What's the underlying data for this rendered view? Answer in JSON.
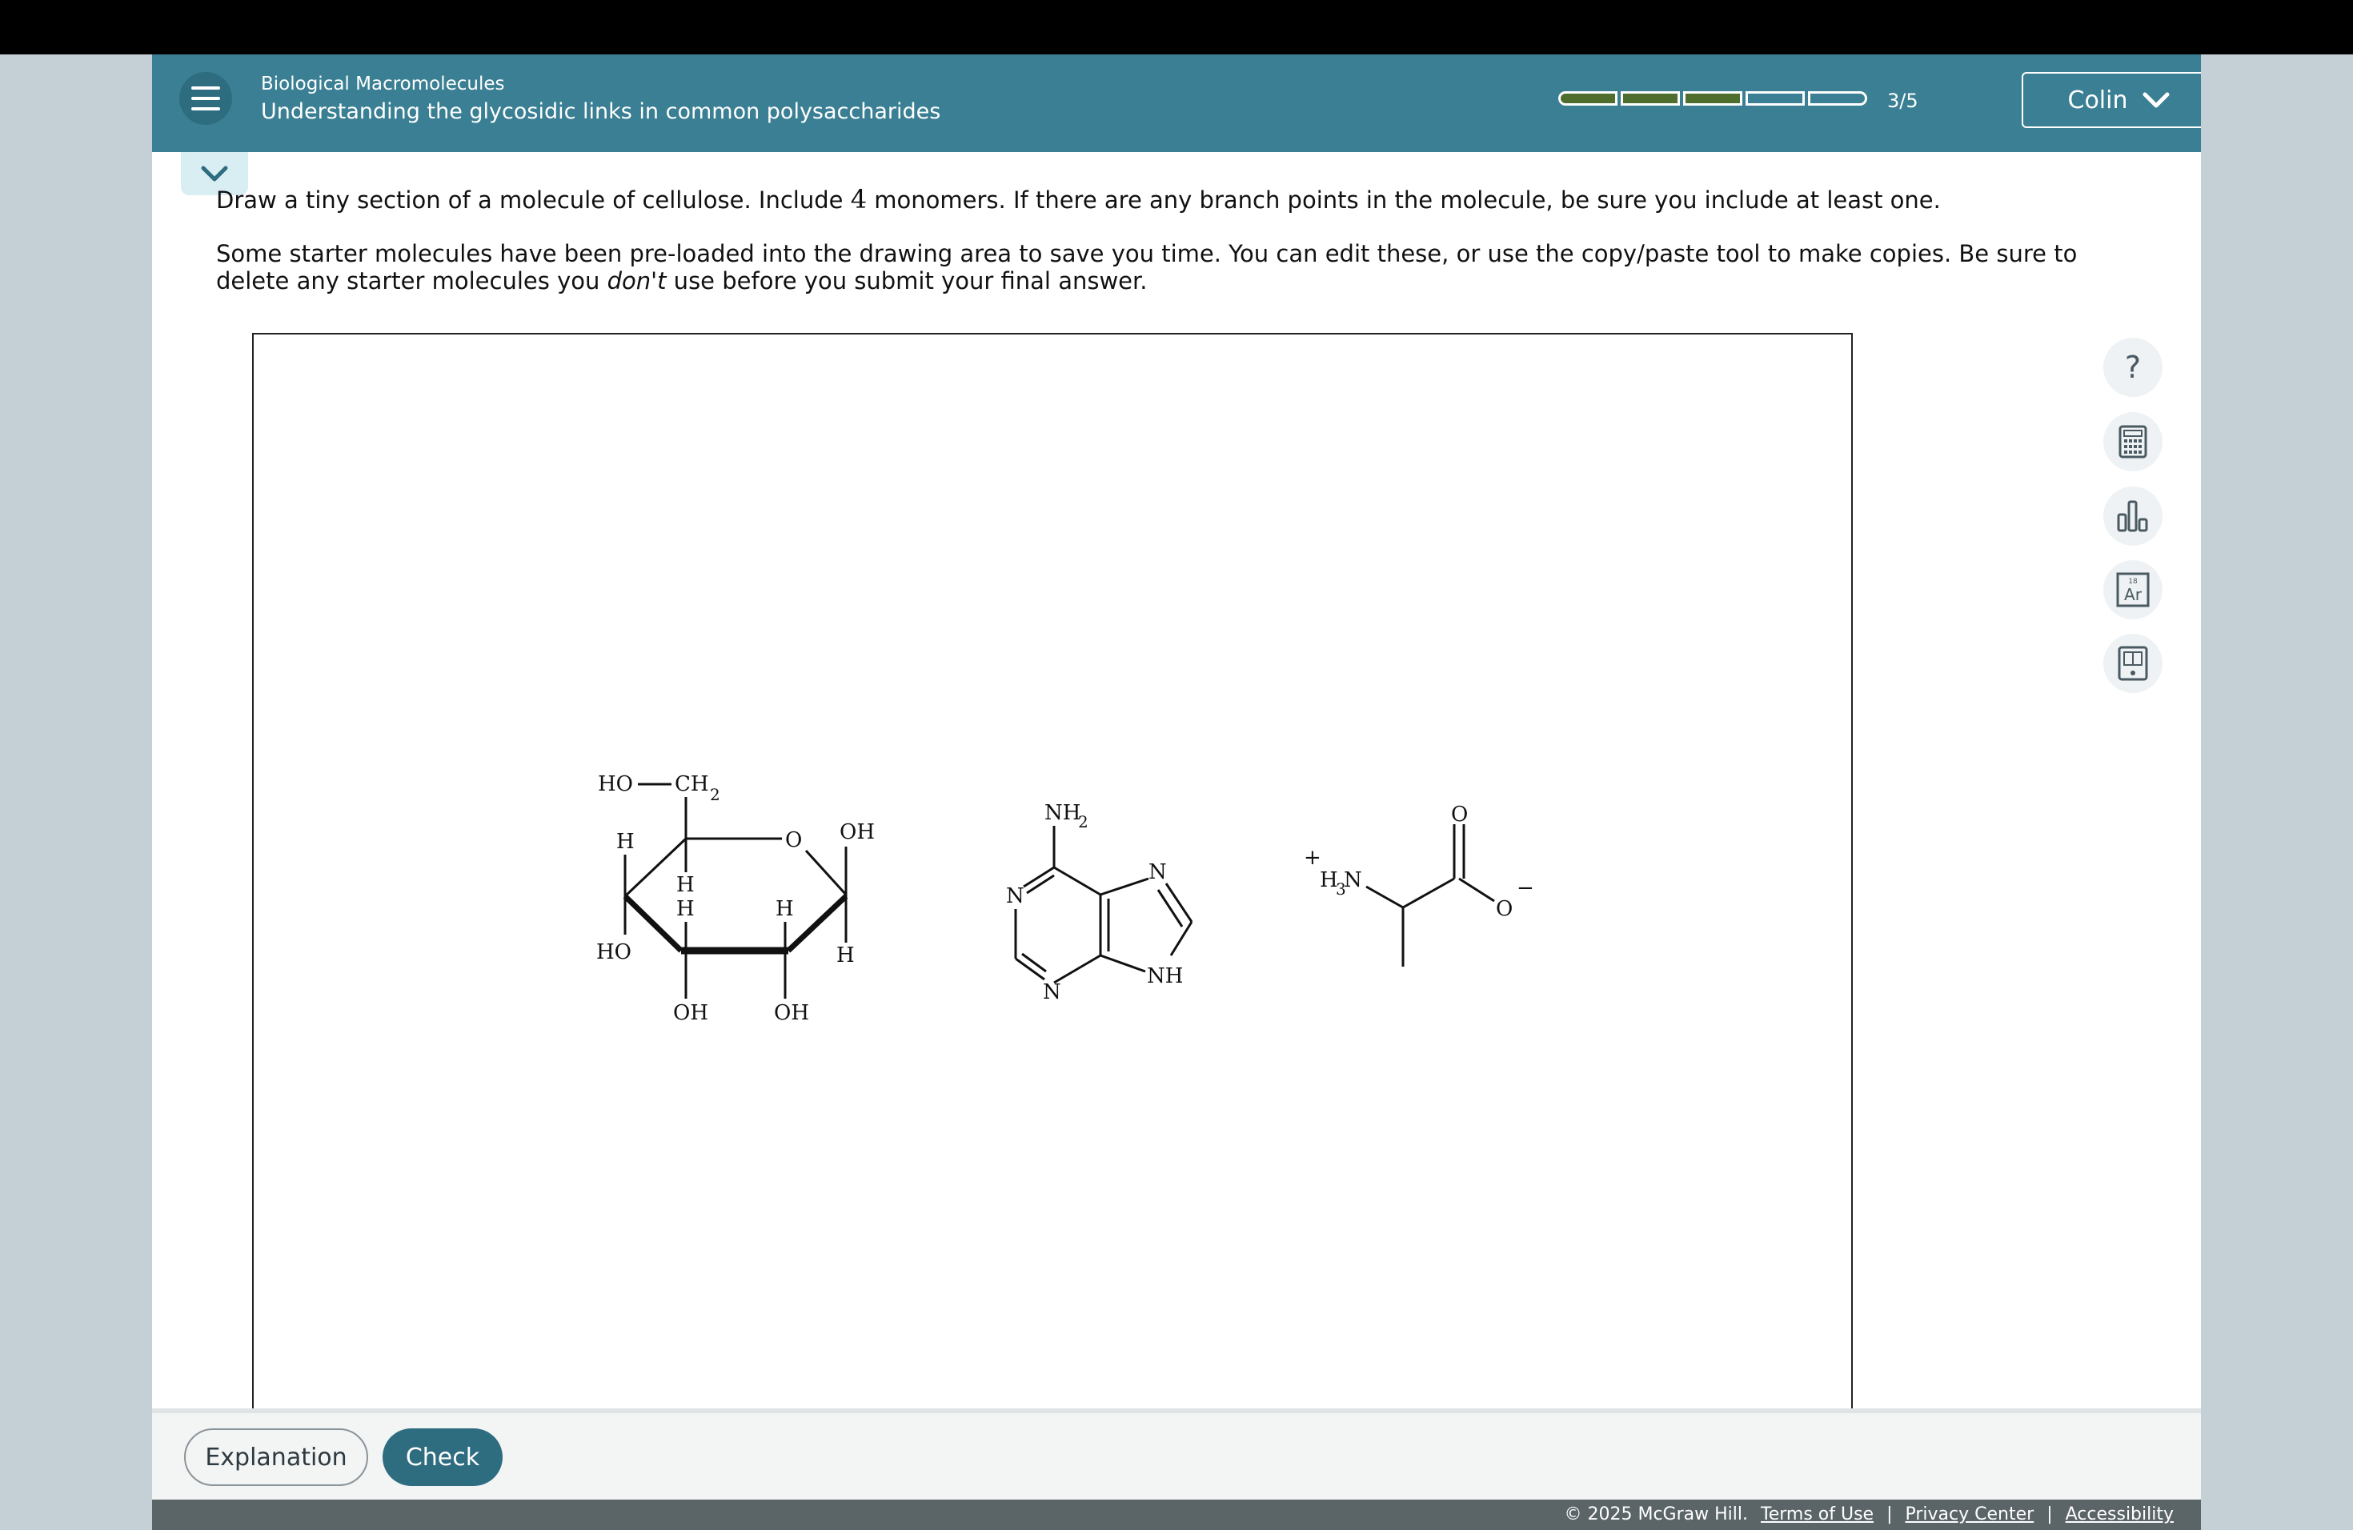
{
  "header": {
    "course": "Biological Macromolecules",
    "module": "Understanding the glycosidic links in common polysaccharides",
    "progress_label": "3/5",
    "progress_filled": 3,
    "progress_total": 5,
    "user": "Colin"
  },
  "question": {
    "p1_a": "Draw a tiny section of a molecule of cellulose. Include ",
    "p1_num": "4",
    "p1_b": " monomers. If there are any branch points in the molecule, be sure you include at least one.",
    "p2_a": "Some starter molecules have been pre-loaded into the drawing area to save you time. You can edit these, or use the copy/paste tool to make copies. Be sure to delete any starter molecules you ",
    "p2_em": "don't",
    "p2_b": " use before you submit your final answer."
  },
  "molecules": {
    "glucose": {
      "HO": "HO",
      "CH": "CH",
      "sub2": "2",
      "O": "O",
      "OH": "OH",
      "H": "H"
    },
    "adenine": {
      "NH": "NH",
      "sub2": "2",
      "N": "N",
      "NH_ring": "NH"
    },
    "alanine": {
      "plus": "+",
      "H": "H",
      "sub3": "3",
      "N": "N",
      "O": "O",
      "minus": "−"
    }
  },
  "tools": [
    "help-icon",
    "calculator-icon",
    "bar-chart-icon",
    "periodic-table-icon",
    "reference-icon"
  ],
  "tool_labels": {
    "help": "?",
    "periodic_number": "18",
    "periodic_symbol": "Ar"
  },
  "footer": {
    "explanation": "Explanation",
    "check": "Check",
    "copyright": "© 2025 McGraw Hill.",
    "terms": "Terms of Use",
    "sep": "|",
    "privacy": "Privacy Center",
    "accessibility": "Accessibility"
  },
  "colors": {
    "header": "#3a7f93",
    "progress_fill": "#4f6d2d",
    "check_button": "#2e6c80"
  }
}
